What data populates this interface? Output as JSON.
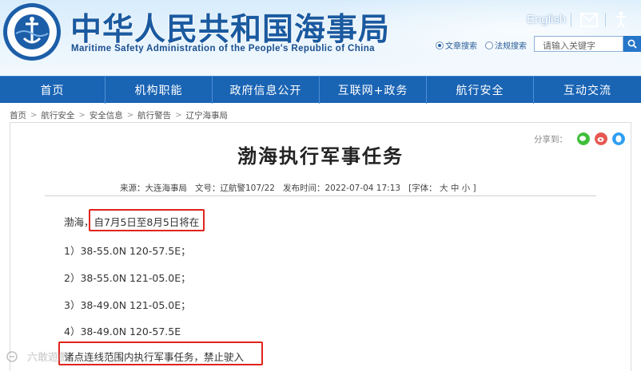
{
  "header": {
    "title": "中华人民共和国海事局",
    "subtitle": "Maritime Safety Administration of the People's Republic of China",
    "logo_text": "CHINA MSA",
    "logo_top": "中 国 海 事",
    "english_link": "English",
    "mail_icon": "mail-icon",
    "access_icon": "accessibility-icon",
    "search": {
      "radio_options": [
        "文章搜索",
        "法规搜索"
      ],
      "placeholder": "请输入关键字",
      "button_icon": "search-icon"
    }
  },
  "nav": {
    "items": [
      "首页",
      "机构职能",
      "政府信息公开",
      "互联网+政务",
      "航行安全",
      "互动交流"
    ]
  },
  "breadcrumb": [
    "首页",
    "航行安全",
    "安全信息",
    "航行警告",
    "辽宁海事局"
  ],
  "share": {
    "label": "分享到：",
    "icons": [
      "wechat-icon",
      "weibo-icon",
      "qzone-icon"
    ]
  },
  "article": {
    "title": "渤海执行军事任务",
    "meta": {
      "source": "来源：大连海事局",
      "doc_no": "文号：辽航警107/22",
      "published": "发布时间：2022-07-04 17:13",
      "font": "[字体：  大  中  小 ]"
    },
    "lines": [
      "渤海，自7月5日至8月5日将在",
      "1）38-55.0N    120-57.5E；",
      "2）38-55.0N    121-05.0E；",
      "3）38-49.0N    121-05.0E；",
      "4）38-49.0N    120-57.5E",
      "诸点连线范围内执行军事任务，禁止驶入"
    ]
  },
  "watermark": "六敢遊戲",
  "colors": {
    "nav": "#1a64b4",
    "highlight": "#e0241d",
    "title_blue": "#1a5aa0"
  }
}
